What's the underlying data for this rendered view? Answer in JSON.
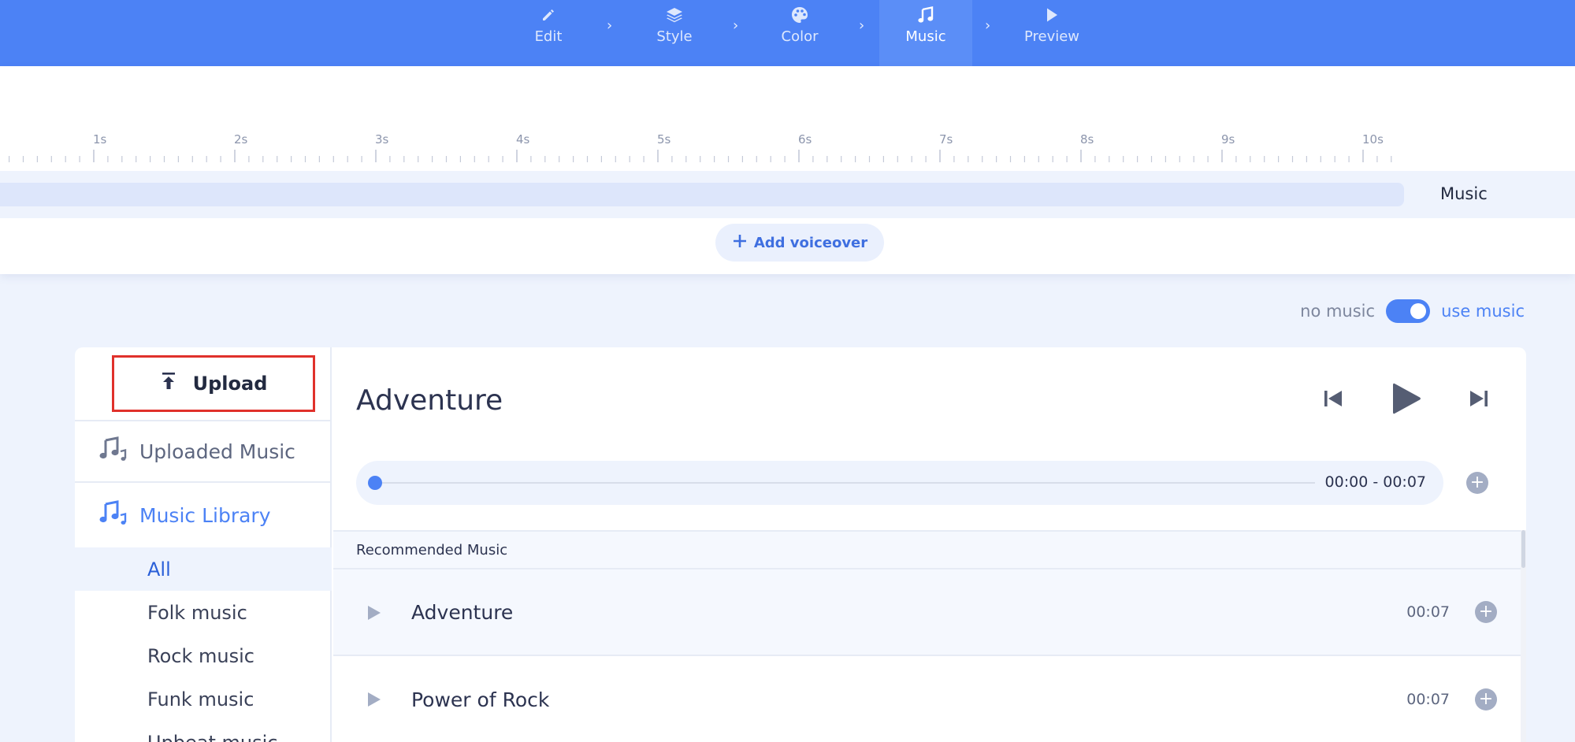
{
  "nav": {
    "steps": [
      {
        "label": "Edit",
        "icon": "pencil-icon"
      },
      {
        "label": "Style",
        "icon": "layers-icon"
      },
      {
        "label": "Color",
        "icon": "palette-icon"
      },
      {
        "label": "Music",
        "icon": "music-note-icon",
        "active": true
      },
      {
        "label": "Preview",
        "icon": "play-icon"
      }
    ]
  },
  "timeline": {
    "ticks": [
      "1s",
      "2s",
      "3s",
      "4s",
      "5s",
      "6s",
      "7s",
      "8s",
      "9s",
      "10s"
    ],
    "track_label": "Music",
    "voiceover_label": "Add voiceover"
  },
  "toggle": {
    "off_label": "no music",
    "on_label": "use music",
    "enabled": true
  },
  "sidebar": {
    "upload_label": "Upload",
    "uploaded_label": "Uploaded Music",
    "library_label": "Music Library",
    "categories": [
      "All",
      "Folk music",
      "Rock music",
      "Funk music",
      "Upbeat music"
    ],
    "selected_category": "All"
  },
  "player": {
    "title": "Adventure",
    "time": "00:00 - 00:07",
    "progress": 0
  },
  "list": {
    "header": "Recommended Music",
    "tracks": [
      {
        "name": "Adventure",
        "duration": "00:07"
      },
      {
        "name": "Power of Rock",
        "duration": "00:07"
      }
    ]
  },
  "colors": {
    "accent": "#4c82f5",
    "highlight_border": "#e0312b",
    "background": "#eef3fd"
  }
}
